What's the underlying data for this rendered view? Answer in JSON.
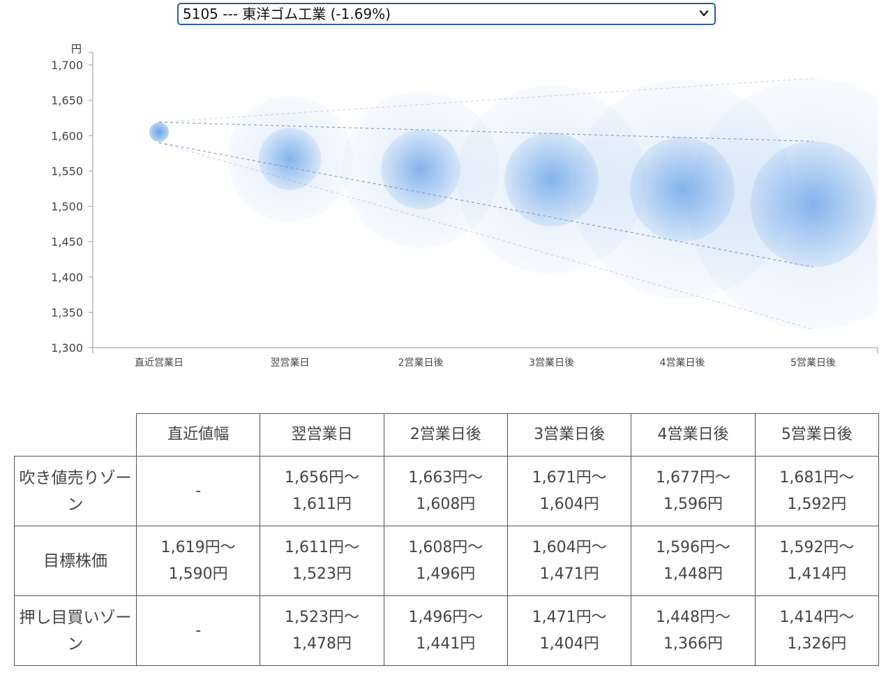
{
  "selector": {
    "value": "5105 --- 東洋ゴム工業 (-1.69%)"
  },
  "chart_data": {
    "type": "scatter",
    "ylabel": "円",
    "ylim": [
      1300,
      1700
    ],
    "yticks": [
      1300,
      1350,
      1400,
      1450,
      1500,
      1550,
      1600,
      1650,
      1700
    ],
    "ytick_labels": [
      "1,300",
      "1,350",
      "1,400",
      "1,450",
      "1,500",
      "1,550",
      "1,600",
      "1,650",
      "1,700"
    ],
    "categories": [
      "直近営業日",
      "翌営業日",
      "2営業日後",
      "3営業日後",
      "4営業日後",
      "5営業日後"
    ],
    "center": [
      1605,
      1567,
      1552,
      1538,
      1524,
      1503
    ],
    "target_upper": [
      1619,
      1611,
      1608,
      1604,
      1596,
      1592
    ],
    "target_lower": [
      1590,
      1523,
      1496,
      1471,
      1448,
      1414
    ],
    "sell_upper": [
      1619,
      1656,
      1663,
      1671,
      1677,
      1681
    ],
    "buy_lower": [
      1590,
      1478,
      1441,
      1404,
      1366,
      1326
    ],
    "colors": {
      "bubble": "#3a86e0",
      "line": "#6f93c4",
      "axis": "#999999"
    }
  },
  "table": {
    "headers": [
      "",
      "直近値幅",
      "翌営業日",
      "2営業日後",
      "3営業日後",
      "4営業日後",
      "5営業日後"
    ],
    "rows": [
      {
        "label": "吹き値売りゾーン",
        "cells": [
          [
            "-",
            ""
          ],
          [
            "1,656円〜",
            "1,611円"
          ],
          [
            "1,663円〜",
            "1,608円"
          ],
          [
            "1,671円〜",
            "1,604円"
          ],
          [
            "1,677円〜",
            "1,596円"
          ],
          [
            "1,681円〜",
            "1,592円"
          ]
        ]
      },
      {
        "label": "目標株価",
        "cells": [
          [
            "1,619円〜",
            "1,590円"
          ],
          [
            "1,611円〜",
            "1,523円"
          ],
          [
            "1,608円〜",
            "1,496円"
          ],
          [
            "1,604円〜",
            "1,471円"
          ],
          [
            "1,596円〜",
            "1,448円"
          ],
          [
            "1,592円〜",
            "1,414円"
          ]
        ]
      },
      {
        "label": "押し目買いゾーン",
        "cells": [
          [
            "-",
            ""
          ],
          [
            "1,523円〜",
            "1,478円"
          ],
          [
            "1,496円〜",
            "1,441円"
          ],
          [
            "1,471円〜",
            "1,404円"
          ],
          [
            "1,448円〜",
            "1,366円"
          ],
          [
            "1,414円〜",
            "1,326円"
          ]
        ]
      }
    ]
  }
}
